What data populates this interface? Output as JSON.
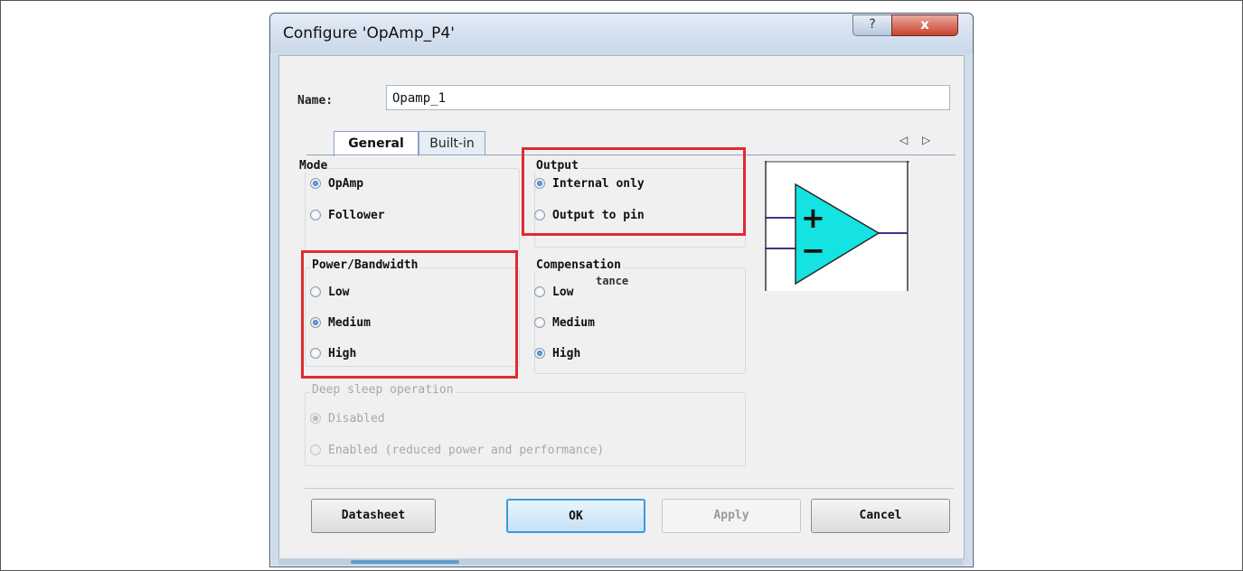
{
  "window": {
    "title": "Configure 'OpAmp_P4'",
    "help_symbol": "?",
    "close_symbol": "x"
  },
  "name_field": {
    "label": "Name:",
    "value": "Opamp_1"
  },
  "tabs": [
    {
      "label": "General",
      "active": true
    },
    {
      "label": "Built-in",
      "active": false
    }
  ],
  "tab_scroll": "◁ ▷",
  "mode": {
    "title": "Mode",
    "options": [
      {
        "label": "OpAmp",
        "selected": true
      },
      {
        "label": "Follower",
        "selected": false
      }
    ]
  },
  "output": {
    "title": "Output",
    "options": [
      {
        "label": "Internal only",
        "selected": true
      },
      {
        "label": "Output to pin",
        "selected": false
      }
    ]
  },
  "power_bandwidth": {
    "title": "Power/Bandwidth",
    "options": [
      {
        "label": "Low",
        "selected": false
      },
      {
        "label": "Medium",
        "selected": true
      },
      {
        "label": "High",
        "selected": false
      }
    ]
  },
  "compensation": {
    "title": "Compensation",
    "overlap_text": "tance",
    "options": [
      {
        "label": "Low",
        "selected": false
      },
      {
        "label": "Medium",
        "selected": false
      },
      {
        "label": "High",
        "selected": true
      }
    ]
  },
  "deep_sleep": {
    "title": "Deep sleep operation",
    "options": [
      {
        "label": "Disabled",
        "selected": true
      },
      {
        "label": "Enabled (reduced power and performance)",
        "selected": false
      }
    ]
  },
  "opamp_symbol": {
    "plus": "+",
    "minus": "−",
    "fill": "#14e3e1"
  },
  "buttons": {
    "datasheet": "Datasheet",
    "ok": "OK",
    "apply": "Apply",
    "cancel": "Cancel"
  },
  "colors": {
    "highlight": "#e02a33",
    "accent": "#3c9bd6"
  }
}
